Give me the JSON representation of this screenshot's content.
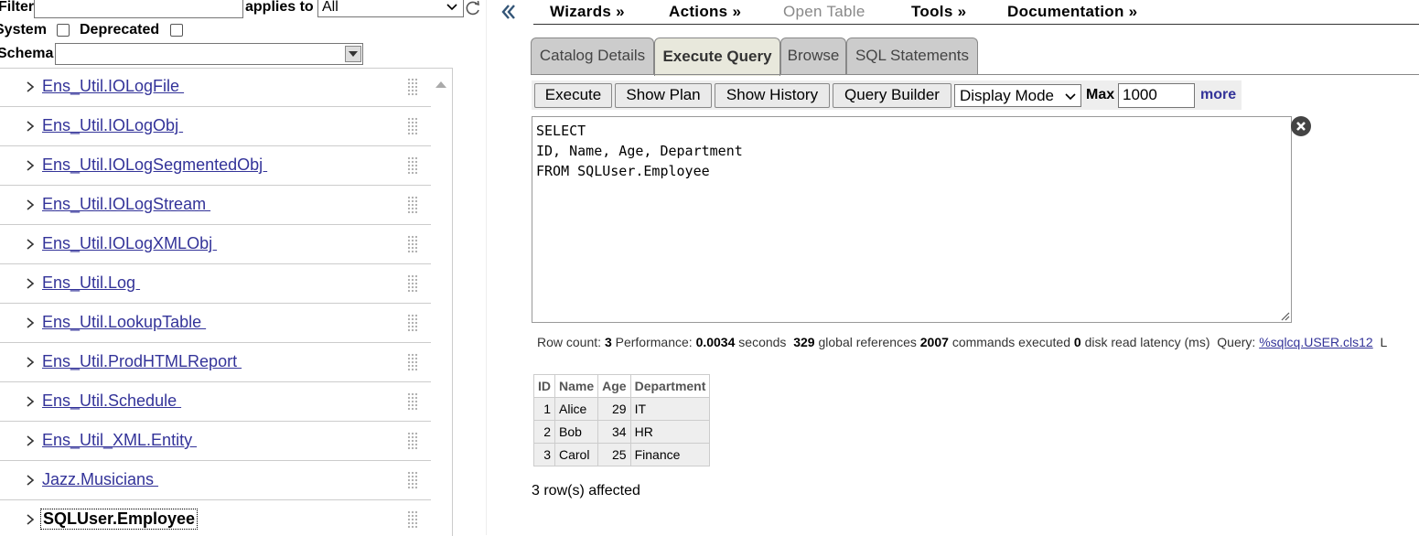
{
  "filter": {
    "label": "Filter",
    "value": "",
    "applies_label": "applies to",
    "applies_value": "All"
  },
  "options": {
    "system_label": "System",
    "deprecated_label": "Deprecated"
  },
  "schema": {
    "label": "Schema",
    "value": ""
  },
  "tree_items": [
    "Ens_Util.IOLogFile ",
    "Ens_Util.IOLogObj ",
    "Ens_Util.IOLogSegmentedObj ",
    "Ens_Util.IOLogStream ",
    "Ens_Util.IOLogXMLObj ",
    "Ens_Util.Log ",
    "Ens_Util.LookupTable ",
    "Ens_Util.ProdHTMLReport ",
    "Ens_Util.Schedule ",
    "Ens_Util_XML.Entity ",
    "Jazz.Musicians ",
    "SQLUser.Employee"
  ],
  "menu": {
    "wizards": "Wizards »",
    "actions": "Actions »",
    "open_table": "Open Table",
    "tools": "Tools »",
    "documentation": "Documentation »"
  },
  "tabs": [
    "Catalog Details",
    "Execute Query",
    "Browse",
    "SQL Statements"
  ],
  "toolbar": {
    "execute": "Execute",
    "show_plan": "Show Plan",
    "show_history": "Show History",
    "query_builder": "Query Builder",
    "display_mode": "Display Mode",
    "max_label": "Max",
    "max_value": "1000",
    "more": "more"
  },
  "query_text": "SELECT\nID, Name, Age, Department\nFROM SQLUser.Employee",
  "stats": {
    "row_count_label": "Row count:",
    "row_count": "3",
    "performance_label": "Performance:",
    "performance": "0.0034",
    "seconds_label": "seconds",
    "global_refs": "329",
    "global_refs_label": "global references",
    "commands": "2007",
    "commands_label": "commands executed",
    "disk_latency": "0",
    "disk_latency_label": "disk read latency (ms)",
    "query_label": "Query:",
    "query_link": "%sqlcq.USER.cls12",
    "trailing": "L"
  },
  "results": {
    "headers": [
      "ID",
      "Name",
      "Age",
      "Department"
    ],
    "rows": [
      [
        "1",
        "Alice",
        "29",
        "IT"
      ],
      [
        "2",
        "Bob",
        "34",
        "HR"
      ],
      [
        "3",
        "Carol",
        "25",
        "Finance"
      ]
    ]
  },
  "affected": "3 row(s) affected",
  "colors": {
    "link": "#333399",
    "tab_active": "#e8e8dc",
    "tab_inactive": "#cccccc"
  }
}
